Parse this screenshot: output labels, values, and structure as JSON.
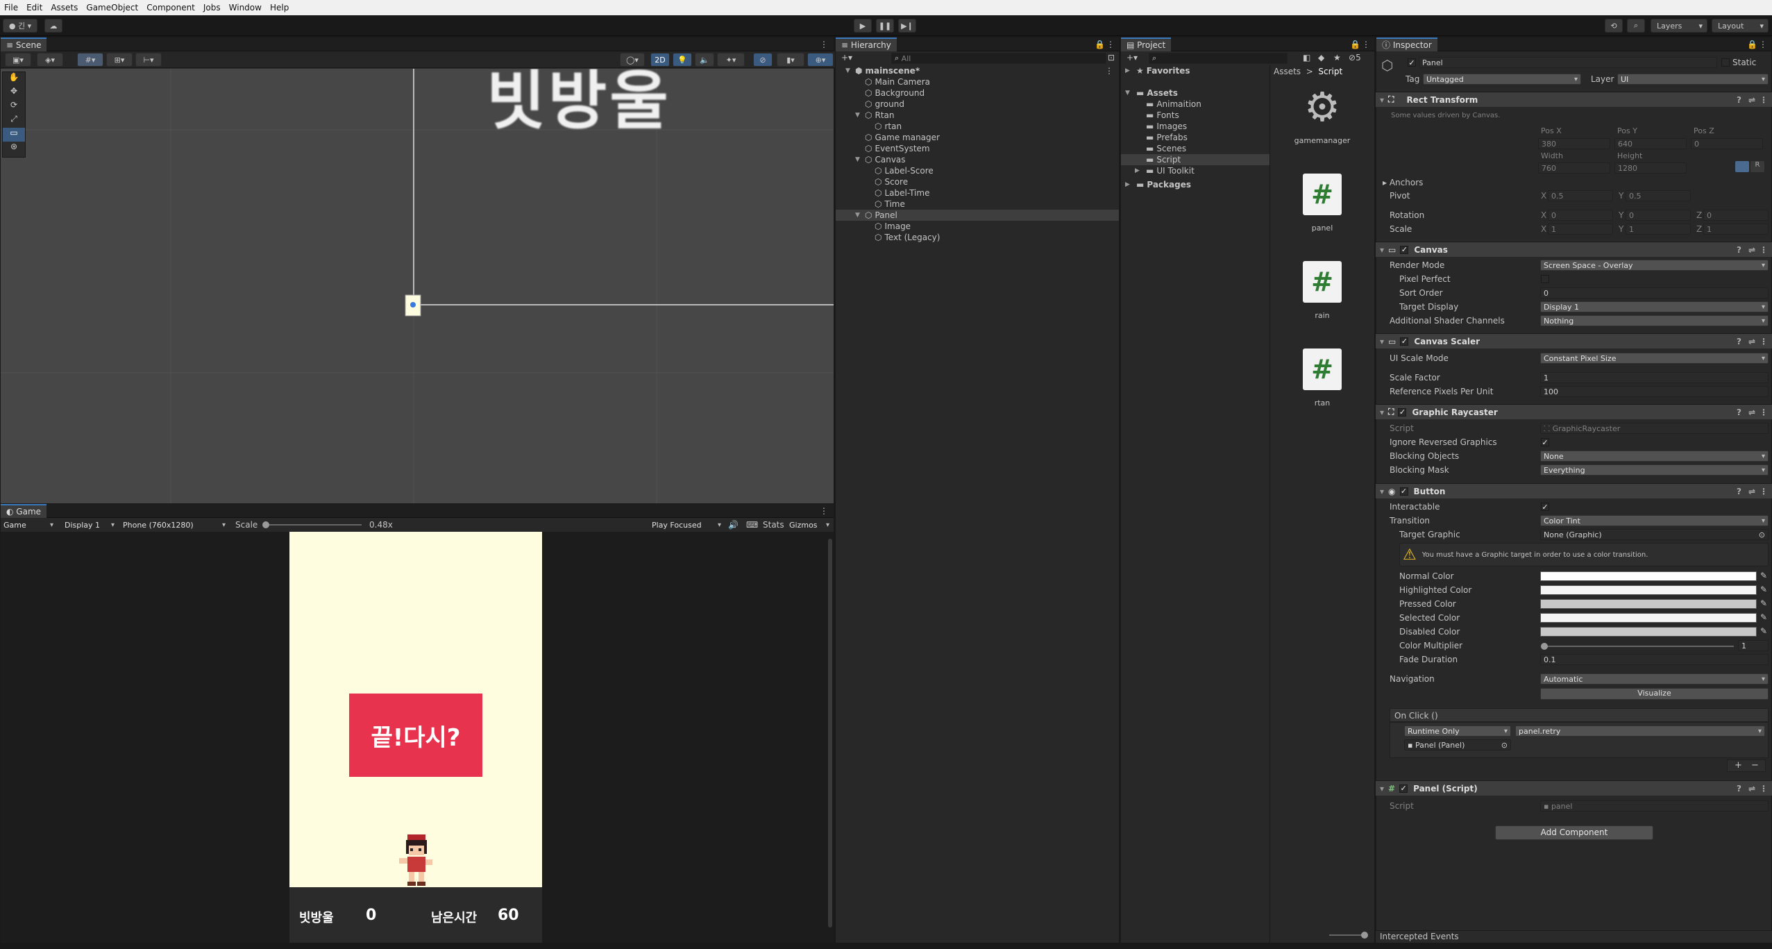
{
  "menu": [
    "File",
    "Edit",
    "Assets",
    "GameObject",
    "Component",
    "Jobs",
    "Window",
    "Help"
  ],
  "toolbar": {
    "account": "긴",
    "layers": "Layers",
    "layout": "Layout"
  },
  "scene": {
    "tab": "Scene",
    "mode_2d": "2D",
    "title_text": "빗방울"
  },
  "game": {
    "tab": "Game",
    "view_mode": "Game",
    "display": "Display 1",
    "resolution": "Phone (760x1280)",
    "scale_label": "Scale",
    "scale_value": "0.48x",
    "play_mode": "Play Focused",
    "stats": "Stats",
    "gizmos": "Gizmos",
    "button_text": "끝!다시?",
    "score_label": "빗방울",
    "score_value": "0",
    "time_label": "남은시간",
    "time_value": "60",
    "bg_color": "#fffde0",
    "button_color": "#e8334f"
  },
  "hierarchy": {
    "tab": "Hierarchy",
    "search_placeholder": "All",
    "items": [
      {
        "label": "mainscene*",
        "depth": 0,
        "scene": true
      },
      {
        "label": "Main Camera",
        "depth": 1
      },
      {
        "label": "Background",
        "depth": 1
      },
      {
        "label": "ground",
        "depth": 1
      },
      {
        "label": "Rtan",
        "depth": 1,
        "fold": true
      },
      {
        "label": "rtan",
        "depth": 2
      },
      {
        "label": "Game manager",
        "depth": 1
      },
      {
        "label": "EventSystem",
        "depth": 1
      },
      {
        "label": "Canvas",
        "depth": 1,
        "fold": true
      },
      {
        "label": "Label-Score",
        "depth": 2
      },
      {
        "label": "Score",
        "depth": 2
      },
      {
        "label": "Label-Time",
        "depth": 2
      },
      {
        "label": "Time",
        "depth": 2
      },
      {
        "label": "Panel",
        "depth": 1,
        "fold": true,
        "selected": true
      },
      {
        "label": "Image",
        "depth": 2
      },
      {
        "label": "Text (Legacy)",
        "depth": 2
      }
    ]
  },
  "project": {
    "tab": "Project",
    "badge": "5",
    "tree": [
      {
        "label": "Favorites",
        "depth": 0,
        "bold": true
      },
      {
        "label": "Assets",
        "depth": 0,
        "bold": true
      },
      {
        "label": "Animaition",
        "depth": 1
      },
      {
        "label": "Fonts",
        "depth": 1
      },
      {
        "label": "Images",
        "depth": 1
      },
      {
        "label": "Prefabs",
        "depth": 1
      },
      {
        "label": "Scenes",
        "depth": 1
      },
      {
        "label": "Script",
        "depth": 1,
        "selected": true
      },
      {
        "label": "UI Toolkit",
        "depth": 1
      },
      {
        "label": "Packages",
        "depth": 0,
        "bold": true
      }
    ],
    "breadcrumb": [
      "Assets",
      "Script"
    ],
    "files": [
      {
        "name": "gamemanager",
        "icon": "gear-icon"
      },
      {
        "name": "panel",
        "icon": "script-icon"
      },
      {
        "name": "rain",
        "icon": "script-icon"
      },
      {
        "name": "rtan",
        "icon": "script-icon"
      }
    ]
  },
  "inspector": {
    "tab": "Inspector",
    "object_name": "Panel",
    "static_label": "Static",
    "tag_label": "Tag",
    "tag_value": "Untagged",
    "layer_label": "Layer",
    "layer_value": "UI",
    "rect_transform": {
      "title": "Rect Transform",
      "note": "Some values driven by Canvas.",
      "pos_x_label": "Pos X",
      "pos_y_label": "Pos Y",
      "pos_z_label": "Pos Z",
      "pos_x": "380",
      "pos_y": "640",
      "pos_z": "0",
      "width_label": "Width",
      "height_label": "Height",
      "width": "760",
      "height": "1280",
      "anchors": "Anchors",
      "pivot": "Pivot",
      "pivot_x": "0.5",
      "pivot_y": "0.5",
      "rotation": "Rotation",
      "rot_x": "0",
      "rot_y": "0",
      "rot_z": "0",
      "scale": "Scale",
      "scale_x": "1",
      "scale_y": "1",
      "scale_z": "1"
    },
    "canvas": {
      "title": "Canvas",
      "render_mode_label": "Render Mode",
      "render_mode": "Screen Space - Overlay",
      "pixel_perfect": "Pixel Perfect",
      "sort_order_label": "Sort Order",
      "sort_order": "0",
      "target_display_label": "Target Display",
      "target_display": "Display 1",
      "shader_channels_label": "Additional Shader Channels",
      "shader_channels": "Nothing"
    },
    "canvas_scaler": {
      "title": "Canvas Scaler",
      "ui_scale_mode_label": "UI Scale Mode",
      "ui_scale_mode": "Constant Pixel Size",
      "scale_factor_label": "Scale Factor",
      "scale_factor": "1",
      "ref_ppu_label": "Reference Pixels Per Unit",
      "ref_ppu": "100"
    },
    "graphic_raycaster": {
      "title": "Graphic Raycaster",
      "script_label": "Script",
      "script": "GraphicRaycaster",
      "ignore_reversed": "Ignore Reversed Graphics",
      "blocking_objects_label": "Blocking Objects",
      "blocking_objects": "None",
      "blocking_mask_label": "Blocking Mask",
      "blocking_mask": "Everything"
    },
    "button": {
      "title": "Button",
      "interactable": "Interactable",
      "transition_label": "Transition",
      "transition": "Color Tint",
      "target_graphic_label": "Target Graphic",
      "target_graphic": "None (Graphic)",
      "warning": "You must have a Graphic target in order to use a color transition.",
      "normal_color": "Normal Color",
      "highlighted_color": "Highlighted Color",
      "pressed_color": "Pressed Color",
      "selected_color": "Selected Color",
      "disabled_color": "Disabled Color",
      "color_multiplier_label": "Color Multiplier",
      "color_multiplier": "1",
      "fade_duration_label": "Fade Duration",
      "fade_duration": "0.1",
      "navigation_label": "Navigation",
      "navigation": "Automatic",
      "visualize": "Visualize",
      "on_click": "On Click ()",
      "runtime": "Runtime Only",
      "function": "panel.retry",
      "target_object": "Panel (Panel)"
    },
    "panel_script": {
      "title": "Panel (Script)",
      "script_label": "Script",
      "script": "panel"
    },
    "add_component": "Add Component",
    "intercepted_events": "Intercepted Events"
  }
}
